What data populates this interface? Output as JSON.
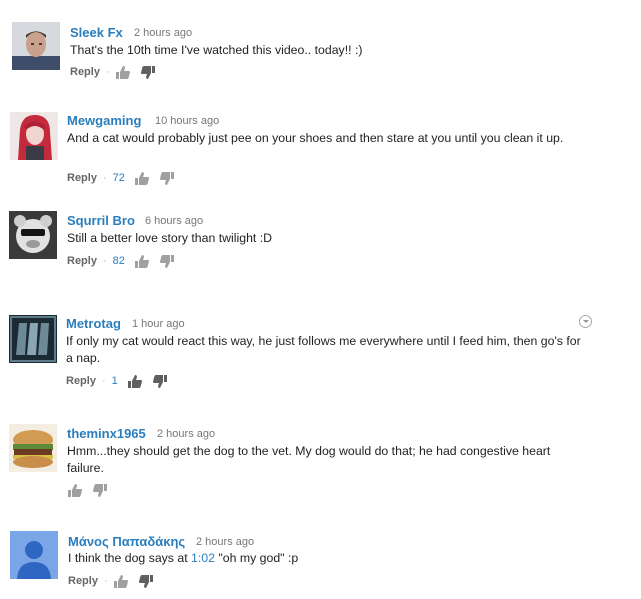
{
  "comments": [
    {
      "author": "Sleek Fx",
      "time": "2 hours ago",
      "text": "That's the 10th time I've watched this video.. today!! :)",
      "reply_label": "Reply",
      "likes": ""
    },
    {
      "author": "Mewgaming",
      "time": "10 hours ago",
      "text": "And a cat would probably just pee on your shoes and then stare at you until you clean it up.",
      "reply_label": "Reply",
      "likes": "72"
    },
    {
      "author": "Squrril Bro",
      "time": "6 hours ago",
      "text": "Still a better love story than twilight :D",
      "reply_label": "Reply",
      "likes": "82"
    },
    {
      "author": "Metrotag",
      "time": "1 hour ago",
      "text": "If only my cat would react this way, he just follows me everywhere until I feed him, then go's for a nap.",
      "reply_label": "Reply",
      "likes": "1"
    },
    {
      "author": "theminx1965",
      "time": "2 hours ago",
      "text": "Hmm...they should get the dog to the vet. My dog would do that; he had congestive heart failure.",
      "reply_label": "",
      "likes": ""
    },
    {
      "author": "Μάνος Παπαδάκης",
      "time": "2 hours ago",
      "text_before": "I think the dog says at ",
      "timestamp_link": "1:02",
      "text_after": " \"oh my god\" :p",
      "reply_label": "Reply",
      "likes": ""
    }
  ],
  "icons": {
    "like": "thumbs-up-icon",
    "dislike": "thumbs-down-icon",
    "menu": "chevron-down-icon"
  },
  "colors": {
    "author": "#2a7ebd",
    "link": "#2a7ebd",
    "meta": "#777777",
    "icon": "#999999"
  }
}
